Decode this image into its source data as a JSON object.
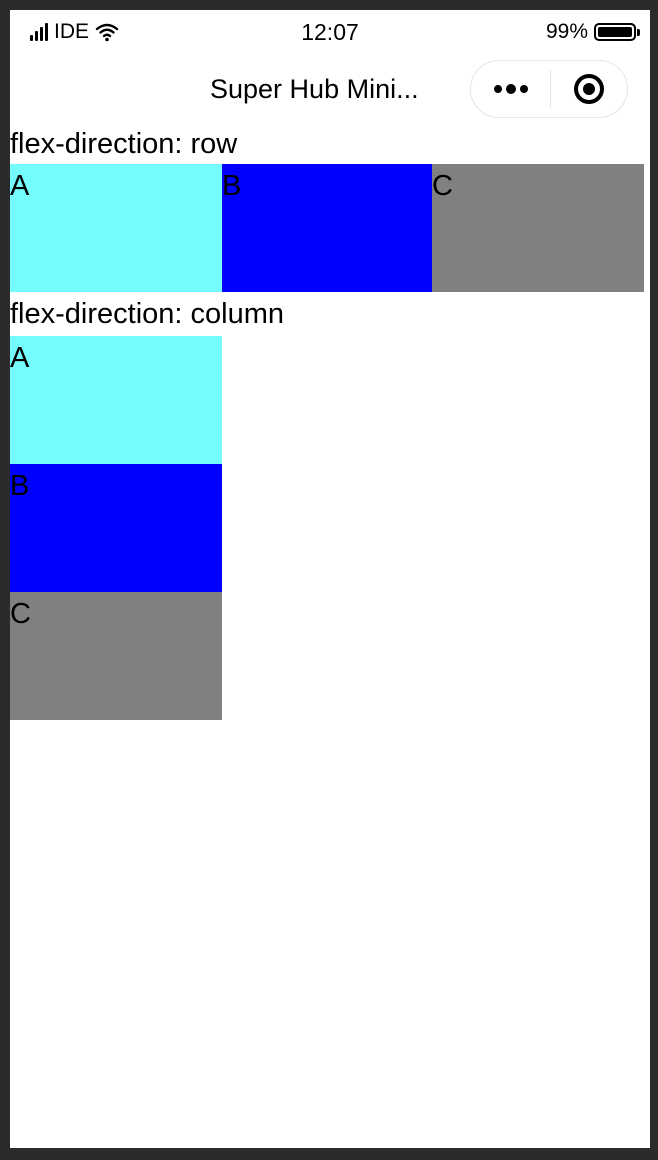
{
  "status_bar": {
    "carrier": "IDE",
    "time": "12:07",
    "battery_percent_label": "99%",
    "battery_level": 0.99,
    "signal_icon": "signal-bars-icon",
    "wifi_icon": "wifi-icon",
    "battery_icon": "battery-icon"
  },
  "nav_bar": {
    "title": "Super Hub Mini...",
    "more_icon": "more-dots-icon",
    "close_icon": "target-icon"
  },
  "sections": [
    {
      "title": "flex-direction: row",
      "items": [
        {
          "label": "A",
          "color": "#74fcfc"
        },
        {
          "label": "B",
          "color": "#0000ff"
        },
        {
          "label": "C",
          "color": "#808080"
        }
      ]
    },
    {
      "title": "flex-direction: column",
      "items": [
        {
          "label": "A",
          "color": "#74fcfc"
        },
        {
          "label": "B",
          "color": "#0000ff"
        },
        {
          "label": "C",
          "color": "#808080"
        }
      ]
    }
  ]
}
